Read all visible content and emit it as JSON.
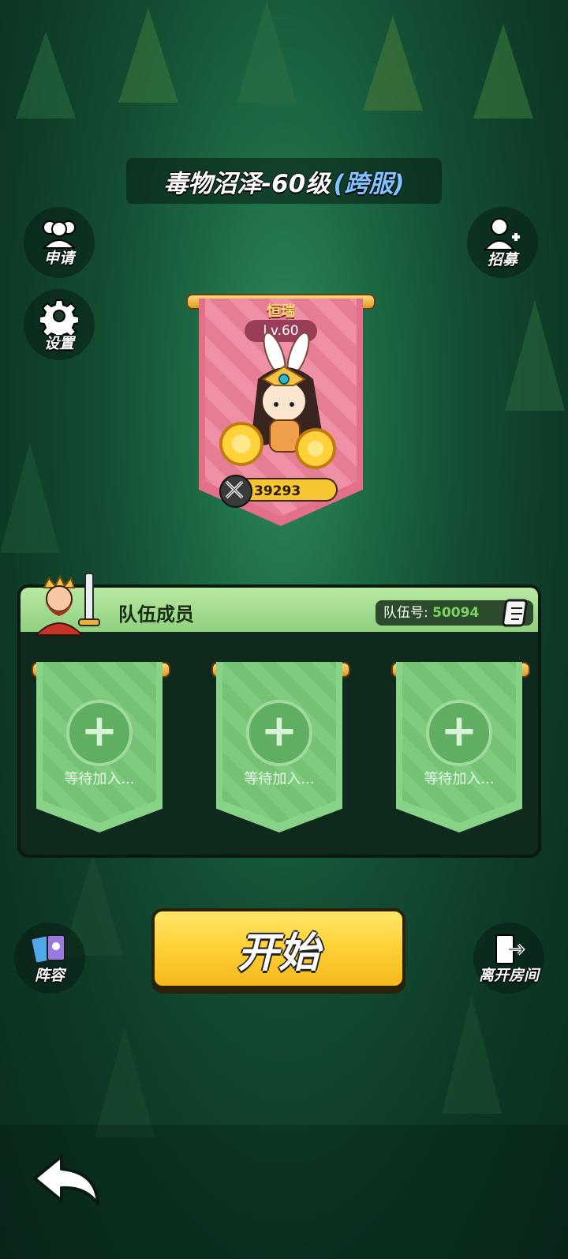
{
  "title": {
    "stage": "毒物沼泽-60级",
    "tag": "(跨服)"
  },
  "left_buttons": {
    "apply": "申请",
    "settings": "设置",
    "lineup": "阵容"
  },
  "right_buttons": {
    "recruit": "招募",
    "leave": "离开房间"
  },
  "leader": {
    "name": "恒瑞",
    "level": "Lv.60",
    "power": "39293"
  },
  "team": {
    "title": "队伍成员",
    "number_label": "队伍号:",
    "number": "50094",
    "slots": [
      {
        "status": "等待加入..."
      },
      {
        "status": "等待加入..."
      },
      {
        "status": "等待加入..."
      }
    ]
  },
  "start_button": "开始",
  "colors": {
    "accent_yellow": "#ffd23a",
    "slot_green": "#89d389",
    "leader_pink": "#e36f88"
  }
}
